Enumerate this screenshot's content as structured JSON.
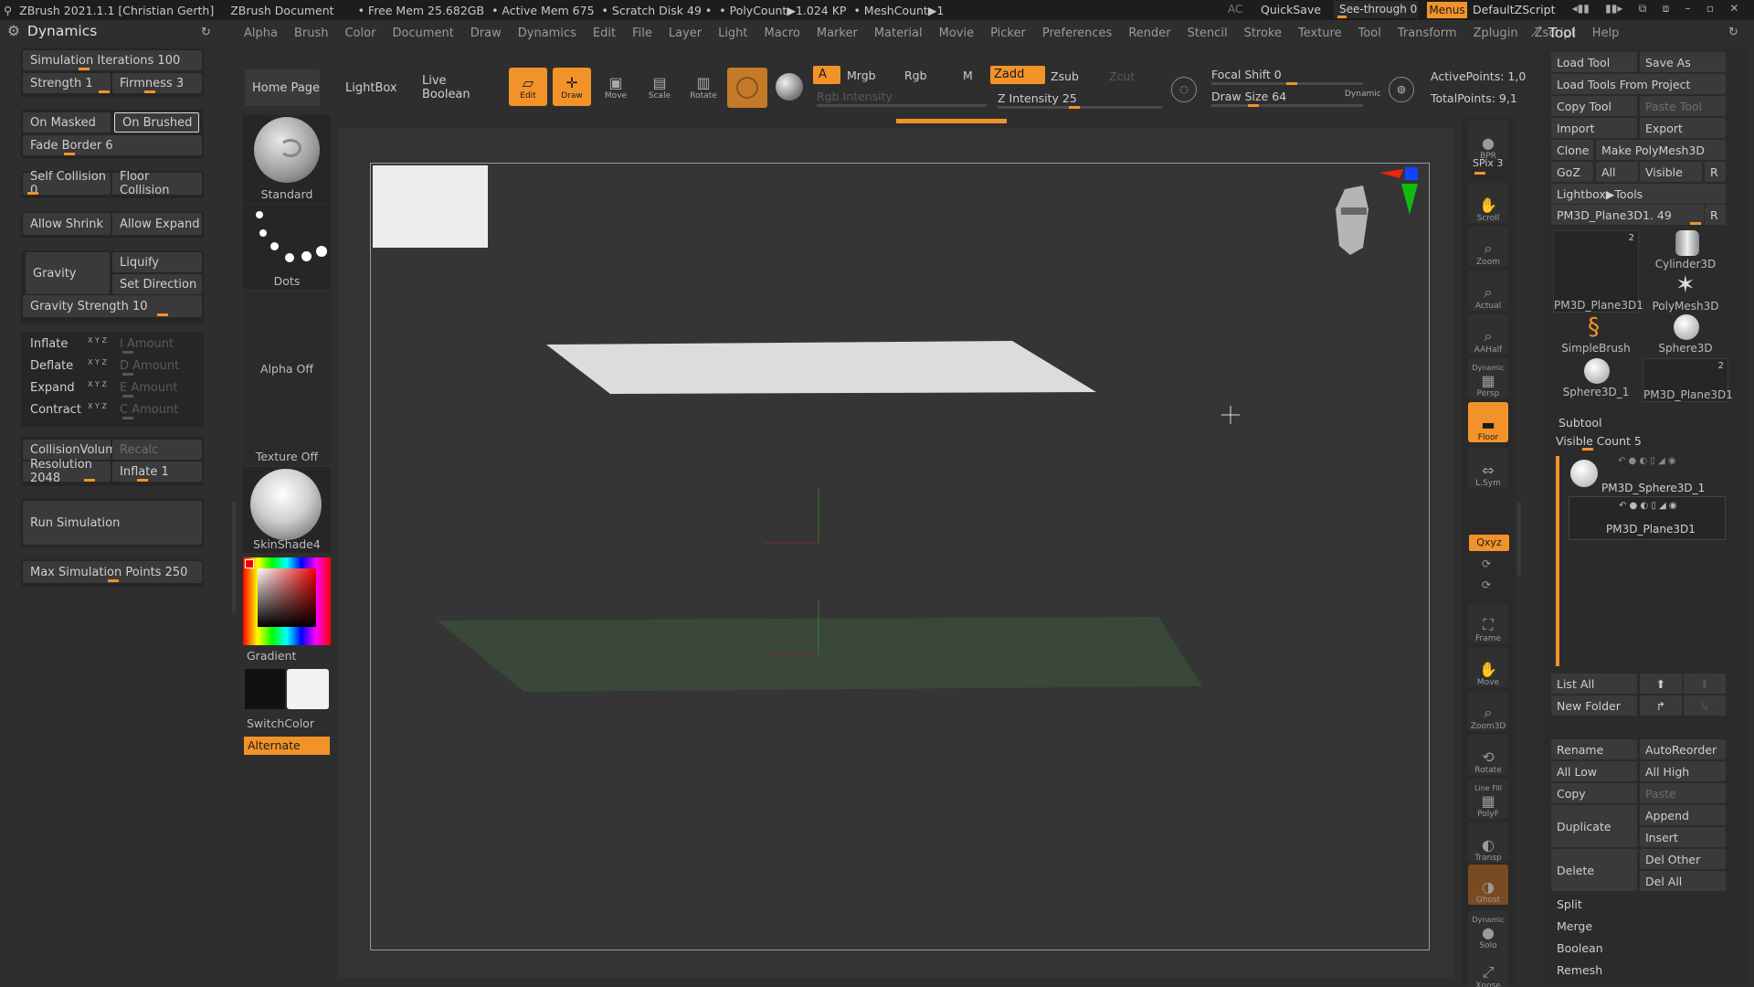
{
  "title": {
    "app": "ZBrush 2021.1.1 [Christian Gerth]",
    "doc": "ZBrush Document",
    "freemem": "• Free Mem 25.682GB",
    "activemem": "• Active Mem 675",
    "scratch": "• Scratch Disk 49 •",
    "polycount": "• PolyCount▶1.024 KP",
    "meshcount": "• MeshCount▶1",
    "ac": "AC",
    "quicksave": "QuickSave",
    "seethrough": "See-through  0",
    "menus": "Menus",
    "defaultz": "DefaultZScript"
  },
  "menu": [
    "Alpha",
    "Brush",
    "Color",
    "Document",
    "Draw",
    "Dynamics",
    "Edit",
    "File",
    "Layer",
    "Light",
    "Macro",
    "Marker",
    "Material",
    "Movie",
    "Picker",
    "Preferences",
    "Render",
    "Stencil",
    "Stroke",
    "Texture",
    "Tool",
    "Transform",
    "Zplugin",
    "Zscript",
    "Help"
  ],
  "dynamics": {
    "title": "Dynamics",
    "sim_iter": "Simulation Iterations 100",
    "strength": "Strength 1",
    "firmness": "Firmness 3",
    "on_masked": "On Masked",
    "on_brushed": "On Brushed",
    "fade_border": "Fade Border 6",
    "self_collision": "Self Collision 0",
    "floor_collision": "Floor Collision",
    "allow_shrink": "Allow Shrink",
    "allow_expand": "Allow Expand",
    "gravity": "Gravity",
    "liquify": "Liquify",
    "set_direction": "Set Direction",
    "gravity_strength": "Gravity Strength 10",
    "inflate": "Inflate",
    "deflate": "Deflate",
    "expand": "Expand",
    "contract": "Contract",
    "xyz": "X Y Z",
    "i_amount": "I Amount",
    "d_amount": "D Amount",
    "e_amount": "E Amount",
    "c_amount": "C Amount",
    "collision_volume": "CollisionVolume",
    "recalc": "Recalc",
    "resolution": "Resolution 2048",
    "inflate1": "Inflate 1",
    "run_sim": "Run Simulation",
    "max_points": "Max Simulation Points 250"
  },
  "shelf": {
    "standard": "Standard",
    "dots": "Dots",
    "alpha_off": "Alpha Off",
    "texture_off": "Texture Off",
    "skinshade": "SkinShade4",
    "gradient": "Gradient",
    "switchcolor": "SwitchColor",
    "alternate": "Alternate"
  },
  "toolbar": {
    "home": "Home Page",
    "lightbox": "LightBox",
    "live_boolean": "Live Boolean",
    "edit": "Edit",
    "draw": "Draw",
    "move": "Move",
    "scale": "Scale",
    "rotate": "Rotate",
    "a": "A",
    "mrgb": "Mrgb",
    "rgb": "Rgb",
    "m": "M",
    "zadd": "Zadd",
    "zsub": "Zsub",
    "zcut": "Zcut",
    "rgb_intensity": "Rgb Intensity",
    "z_intensity": "Z Intensity 25",
    "focal_shift": "Focal Shift 0",
    "draw_size": "Draw Size 64",
    "dynamic": "Dynamic",
    "active_points": "ActivePoints: 1,0",
    "total_points": "TotalPoints: 9,1"
  },
  "rightbar": {
    "bpr": "BPR",
    "spix": "SPix 3",
    "scroll": "Scroll",
    "zoom": "Zoom",
    "actual": "Actual",
    "aahalf": "AAHalf",
    "dynamic": "Dynamic",
    "persp": "Persp",
    "floor": "Floor",
    "lsym": "L.Sym",
    "xyz": "Qxyz",
    "frame": "Frame",
    "move": "Move",
    "zoom3d": "Zoom3D",
    "rotate": "Rotate",
    "linefill": "Line Fill",
    "polyf": "PolyF",
    "transp": "Transp",
    "ghost": "Ghost",
    "solo_dyn": "Dynamic",
    "solo": "Solo",
    "xpose": "Xpose"
  },
  "tool": {
    "title": "Tool",
    "load_tool": "Load Tool",
    "save_as": "Save As",
    "load_from_project": "Load Tools From Project",
    "copy_tool": "Copy Tool",
    "paste_tool": "Paste Tool",
    "import": "Import",
    "export": "Export",
    "clone": "Clone",
    "make_polymesh": "Make PolyMesh3D",
    "goz": "GoZ",
    "all": "All",
    "visible": "Visible",
    "r": "R",
    "lightbox_tools": "Lightbox▶Tools",
    "current": "PM3D_Plane3D1. 49",
    "thumbs": [
      {
        "name": "PM3D_Plane3D1",
        "count": "2"
      },
      {
        "name": "Cylinder3D",
        "count": ""
      },
      {
        "name": "PolyMesh3D",
        "count": ""
      },
      {
        "name": "SimpleBrush",
        "count": ""
      },
      {
        "name": "Sphere3D",
        "count": ""
      },
      {
        "name": "Sphere3D_1",
        "count": ""
      },
      {
        "name": "PM3D_Plane3D1",
        "count": "2"
      }
    ],
    "subtool": "Subtool",
    "visible_count": "Visible Count 5",
    "sub1": "PM3D_Sphere3D_1",
    "sub2": "PM3D_Plane3D1",
    "list_all": "List All",
    "new_folder": "New Folder",
    "rename": "Rename",
    "autoreorder": "AutoReorder",
    "all_low": "All Low",
    "all_high": "All High",
    "copy": "Copy",
    "paste": "Paste",
    "duplicate": "Duplicate",
    "append": "Append",
    "insert": "Insert",
    "delete": "Delete",
    "del_other": "Del Other",
    "del_all": "Del All",
    "split": "Split",
    "merge": "Merge",
    "boolean": "Boolean",
    "remesh": "Remesh"
  }
}
